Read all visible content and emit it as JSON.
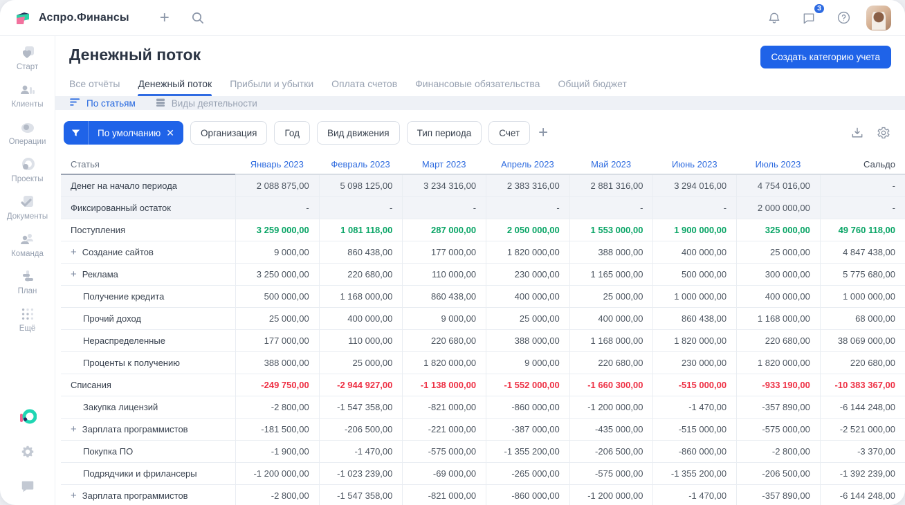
{
  "topbar": {
    "app_name": "Аспро.Финансы",
    "chat_badge": "3"
  },
  "sidebar": {
    "items": [
      {
        "label": "Старт",
        "icon": "start-icon"
      },
      {
        "label": "Клиенты",
        "icon": "clients-icon"
      },
      {
        "label": "Операции",
        "icon": "operations-icon"
      },
      {
        "label": "Проекты",
        "icon": "projects-icon"
      },
      {
        "label": "Документы",
        "icon": "documents-icon"
      },
      {
        "label": "Команда",
        "icon": "team-icon"
      },
      {
        "label": "План",
        "icon": "plan-icon"
      },
      {
        "label": "Ещё",
        "icon": "more-icon"
      }
    ]
  },
  "header": {
    "title": "Денежный поток",
    "create_button": "Создать категорию учета",
    "tabs": [
      {
        "label": "Все отчёты",
        "active": false
      },
      {
        "label": "Денежный поток",
        "active": true
      },
      {
        "label": "Прибыли и убытки",
        "active": false
      },
      {
        "label": "Оплата счетов",
        "active": false
      },
      {
        "label": "Финансовые обязательства",
        "active": false
      },
      {
        "label": "Общий бюджет",
        "active": false
      }
    ],
    "subtabs": [
      {
        "label": "По статьям",
        "active": true,
        "icon": "sort-lines-icon"
      },
      {
        "label": "Виды деятельности",
        "active": false,
        "icon": "stack-icon"
      }
    ]
  },
  "filters": {
    "active_filter": "По умолчанию",
    "chips": [
      "Организация",
      "Год",
      "Вид движения",
      "Тип периода",
      "Счет"
    ]
  },
  "colors": {
    "accent_blue": "#1f63e8",
    "link_blue": "#2e6bdf",
    "positive_green": "#0aa566",
    "negative_red": "#ee3044",
    "shaded_row": "#f2f4f8"
  },
  "table": {
    "columns": [
      "Статья",
      "Январь 2023",
      "Февраль 2023",
      "Март 2023",
      "Апрель 2023",
      "Май 2023",
      "Июнь 2023",
      "Июль 2023",
      "Сальдо"
    ],
    "rows": [
      {
        "label": "Денег на начало периода",
        "shaded": true,
        "indent": 0,
        "expander": false,
        "tone": null,
        "values": [
          "2 088 875,00",
          "5 098 125,00",
          "3 234 316,00",
          "2 383 316,00",
          "2 881 316,00",
          "3 294 016,00",
          "4 754 016,00",
          "-"
        ]
      },
      {
        "label": "Фиксированный остаток",
        "shaded": true,
        "indent": 0,
        "expander": false,
        "tone": null,
        "values": [
          "-",
          "-",
          "-",
          "-",
          "-",
          "-",
          "2 000 000,00",
          "-"
        ]
      },
      {
        "label": "Поступления",
        "shaded": false,
        "indent": 0,
        "expander": false,
        "tone": "green",
        "values": [
          "3 259 000,00",
          "1 081 118,00",
          "287 000,00",
          "2 050 000,00",
          "1 553 000,00",
          "1 900 000,00",
          "325 000,00",
          "49 760 118,00"
        ]
      },
      {
        "label": "Создание сайтов",
        "shaded": false,
        "indent": 1,
        "expander": true,
        "tone": null,
        "values": [
          "9 000,00",
          "860 438,00",
          "177 000,00",
          "1 820 000,00",
          "388 000,00",
          "400 000,00",
          "25 000,00",
          "4 847 438,00"
        ]
      },
      {
        "label": "Реклама",
        "shaded": false,
        "indent": 1,
        "expander": true,
        "tone": null,
        "values": [
          "3 250 000,00",
          "220 680,00",
          "110 000,00",
          "230 000,00",
          "1 165 000,00",
          "500 000,00",
          "300 000,00",
          "5 775 680,00"
        ]
      },
      {
        "label": "Получение кредита",
        "shaded": false,
        "indent": 2,
        "expander": false,
        "tone": null,
        "values": [
          "500 000,00",
          "1 168 000,00",
          "860 438,00",
          "400 000,00",
          "25 000,00",
          "1 000 000,00",
          "400 000,00",
          "1 000 000,00"
        ]
      },
      {
        "label": "Прочий доход",
        "shaded": false,
        "indent": 2,
        "expander": false,
        "tone": null,
        "values": [
          "25 000,00",
          "400 000,00",
          "9 000,00",
          "25 000,00",
          "400 000,00",
          "860 438,00",
          "1 168 000,00",
          "68 000,00"
        ]
      },
      {
        "label": "Нераспределенные",
        "shaded": false,
        "indent": 2,
        "expander": false,
        "tone": null,
        "values": [
          "177 000,00",
          "110 000,00",
          "220 680,00",
          "388 000,00",
          "1 168 000,00",
          "1 820 000,00",
          "220 680,00",
          "38 069 000,00"
        ]
      },
      {
        "label": "Проценты к получению",
        "shaded": false,
        "indent": 2,
        "expander": false,
        "tone": null,
        "values": [
          "388 000,00",
          "25 000,00",
          "1 820 000,00",
          "9 000,00",
          "220 680,00",
          "230 000,00",
          "1 820 000,00",
          "220 680,00"
        ]
      },
      {
        "label": "Списания",
        "shaded": false,
        "indent": 0,
        "expander": false,
        "tone": "red",
        "values": [
          "-249 750,00",
          "-2 944 927,00",
          "-1 138 000,00",
          "-1 552 000,00",
          "-1 660 300,00",
          "-515 000,00",
          "-933 190,00",
          "-10 383 367,00"
        ]
      },
      {
        "label": "Закупка лицензий",
        "shaded": false,
        "indent": 2,
        "expander": false,
        "tone": null,
        "values": [
          "-2 800,00",
          "-1 547 358,00",
          "-821 000,00",
          "-860 000,00",
          "-1 200 000,00",
          "-1 470,00",
          "-357 890,00",
          "-6 144 248,00"
        ]
      },
      {
        "label": "Зарплата программистов",
        "shaded": false,
        "indent": 1,
        "expander": true,
        "tone": null,
        "values": [
          "-181 500,00",
          "-206 500,00",
          "-221 000,00",
          "-387 000,00",
          "-435 000,00",
          "-515 000,00",
          "-575 000,00",
          "-2 521 000,00"
        ]
      },
      {
        "label": "Покупка ПО",
        "shaded": false,
        "indent": 2,
        "expander": false,
        "tone": null,
        "values": [
          "-1 900,00",
          "-1 470,00",
          "-575 000,00",
          "-1 355 200,00",
          "-206 500,00",
          "-860 000,00",
          "-2 800,00",
          "-3 370,00"
        ]
      },
      {
        "label": "Подрядчики и фрилансеры",
        "shaded": false,
        "indent": 2,
        "expander": false,
        "tone": null,
        "values": [
          "-1 200 000,00",
          "-1 023 239,00",
          "-69 000,00",
          "-265 000,00",
          "-575 000,00",
          "-1 355 200,00",
          "-206 500,00",
          "-1 392 239,00"
        ]
      },
      {
        "label": "Зарплата программистов",
        "shaded": false,
        "indent": 1,
        "expander": true,
        "tone": null,
        "values": [
          "-2 800,00",
          "-1 547 358,00",
          "-821 000,00",
          "-860 000,00",
          "-1 200 000,00",
          "-1 470,00",
          "-357 890,00",
          "-6 144 248,00"
        ]
      }
    ]
  }
}
